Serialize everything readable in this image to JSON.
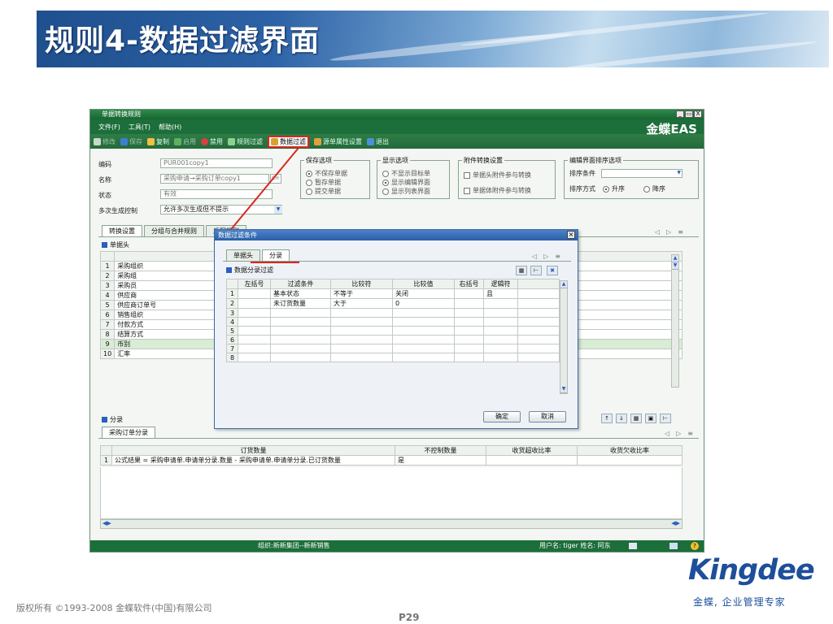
{
  "slide": {
    "title": "规则4-数据过滤界面",
    "copyright": "版权所有 ©1993-2008 金蝶软件(中国)有限公司",
    "page": "P29",
    "logo": "Kingdee",
    "slogan": "金蝶, 企业管理专家"
  },
  "window": {
    "title": "单据转换规则",
    "brand": "金蝶EAS",
    "controls": [
      "_",
      "▭",
      "X"
    ]
  },
  "menu": [
    "文件(F)",
    "工具(T)",
    "帮助(H)"
  ],
  "toolbar": [
    {
      "label": "修改",
      "icon": "pencil-icon",
      "color": "#c8d8c8"
    },
    {
      "label": "保存",
      "icon": "save-icon",
      "color": "#3d7fd0"
    },
    {
      "label": "复制",
      "icon": "copy-icon",
      "color": "#f0c040"
    },
    {
      "label": "启用",
      "icon": "enable-icon",
      "color": "#5fb05f"
    },
    {
      "label": "禁用",
      "icon": "disable-icon",
      "color": "#d94040"
    },
    {
      "label": "规则过滤",
      "icon": "rule-filter-icon",
      "color": "#8fd08f"
    },
    {
      "label": "数据过滤",
      "icon": "data-filter-icon",
      "color": "#d8a030"
    },
    {
      "label": "源单属性设置",
      "icon": "property-icon",
      "color": "#e0a040"
    },
    {
      "label": "退出",
      "icon": "exit-icon",
      "color": "#4a90d8"
    }
  ],
  "form": {
    "code_label": "编码",
    "code_value": "PUR001copy1",
    "name_label": "名称",
    "name_value": "采购申请→采购订单copy1",
    "name_btn": "CH",
    "status_label": "状态",
    "status_value": "有效",
    "multi_label": "多次生成控制",
    "multi_value": "允许多次生成但不提示"
  },
  "save_options": {
    "title": "保存选项",
    "items": [
      "不保存单据",
      "暂存单据",
      "提交单据"
    ],
    "selected": 0
  },
  "display_options": {
    "title": "显示选项",
    "items": [
      "不显示目标单",
      "显示编辑界面",
      "显示列表界面"
    ],
    "selected": 1
  },
  "attach_options": {
    "title": "附件转换设置",
    "items": [
      "单据头附件参与转换",
      "单据体附件参与转换"
    ]
  },
  "sort_options": {
    "title": "编辑界面排序选项",
    "cond_label": "排序条件",
    "mode_label": "排序方式",
    "asc": "升序",
    "desc": "降序"
  },
  "main_tabs": [
    "转换设置",
    "分组与合并规则",
    "反写规则"
  ],
  "header_section": "单据头",
  "header_col": "采",
  "header_rows": [
    "采购组织",
    "采购组",
    "采购员",
    "供应商",
    "供应商订单号",
    "销售组织",
    "付款方式",
    "结算方式",
    "币别",
    "汇率"
  ],
  "entry_section": "分录",
  "entry_tab": "采购订单分录",
  "entry_table": {
    "headers": [
      "订货数量",
      "不控制数量",
      "收货超收比率",
      "收货欠收比率"
    ],
    "rows": [
      [
        "公式结果 = 采购申请单.申请单分录.数量 - 采购申请单.申请单分录.已订货数量",
        "是",
        "",
        ""
      ]
    ]
  },
  "status": {
    "org": "组织:新新集团--新新销售",
    "user": "用户名: tiger 姓名: 阿东"
  },
  "dialog": {
    "title": "数据过滤条件",
    "tabs": [
      "单据头",
      "分录"
    ],
    "section": "数据分录过滤",
    "headers": [
      "左括号",
      "过滤条件",
      "比较符",
      "比较值",
      "右括号",
      "逻辑符"
    ],
    "rows": [
      [
        "",
        "基本状态",
        "不等于",
        "关闭",
        "",
        "且"
      ],
      [
        "",
        "未订货数量",
        "大于",
        "0",
        "",
        ""
      ],
      [
        "",
        "",
        "",
        "",
        "",
        ""
      ],
      [
        "",
        "",
        "",
        "",
        "",
        ""
      ],
      [
        "",
        "",
        "",
        "",
        "",
        ""
      ],
      [
        "",
        "",
        "",
        "",
        "",
        ""
      ],
      [
        "",
        "",
        "",
        "",
        "",
        ""
      ],
      [
        "",
        "",
        "",
        "",
        "",
        ""
      ]
    ],
    "ok": "确定",
    "cancel": "取消"
  }
}
